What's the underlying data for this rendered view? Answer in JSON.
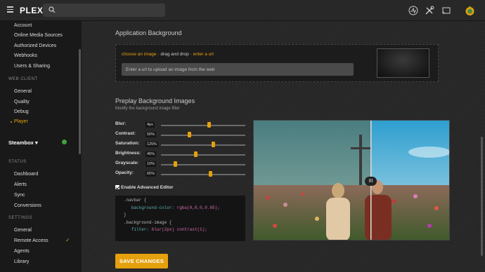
{
  "header": {
    "logo": "PLEX",
    "search_placeholder": "",
    "icons": [
      "menu-icon",
      "search-icon",
      "activity-icon",
      "tools-icon",
      "cast-icon",
      "user-avatar"
    ],
    "accent_color": "#e5a00d"
  },
  "sidebar": {
    "account_items": [
      "Account",
      "Online Media Sources",
      "Authorized Devices",
      "Webhooks",
      "Users & Sharing"
    ],
    "web_client_heading": "WEB CLIENT",
    "web_client_items": [
      "General",
      "Quality",
      "Debug",
      "Player"
    ],
    "active_item": "Player",
    "server_name": "Steambox",
    "status_heading": "STATUS",
    "status_items": [
      "Dashboard",
      "Alerts",
      "Sync",
      "Conversions"
    ],
    "settings_heading": "SETTINGS",
    "settings_items": [
      "General",
      "Remote Access",
      "Agents",
      "Library"
    ]
  },
  "application_background": {
    "title": "Application Background",
    "link_choose": "choose an image",
    "separator": "·",
    "drag_text": "drag and drop",
    "link_url": "enter a url",
    "url_placeholder": "Enter a url to upload an image from the web"
  },
  "preplay": {
    "title": "Preplay Background Images",
    "subtitle": "Modify the background image filter",
    "sliders": [
      {
        "label": "Blur:",
        "value": "4px",
        "fraction": 0.57
      },
      {
        "label": "Contrast:",
        "value": "50%",
        "fraction": 0.34
      },
      {
        "label": "Saturation:",
        "value": "125%",
        "fraction": 0.62
      },
      {
        "label": "Brightness:",
        "value": "45%",
        "fraction": 0.41
      },
      {
        "label": "Grayscale:",
        "value": "10%",
        "fraction": 0.17
      },
      {
        "label": "Opacity:",
        "value": "65%",
        "fraction": 0.59
      }
    ],
    "advanced_editor_label": "Enable Advanced Editor",
    "advanced_editor_checked": true,
    "code_lines": [
      {
        "text": ".navbar {",
        "kind": "sel"
      },
      {
        "prop": "background-color:",
        "val": "rgba(0,0,0,0.65);",
        "kind": "decl"
      },
      {
        "text": "}",
        "kind": "sel"
      },
      {
        "text": "",
        "kind": "sel"
      },
      {
        "text": ".background-image {",
        "kind": "sel"
      },
      {
        "prop": "filter:",
        "val": "blur(2px) contrast(1);",
        "kind": "decl"
      }
    ],
    "compare_handle": "III"
  },
  "save_button": "SAVE CHANGES"
}
